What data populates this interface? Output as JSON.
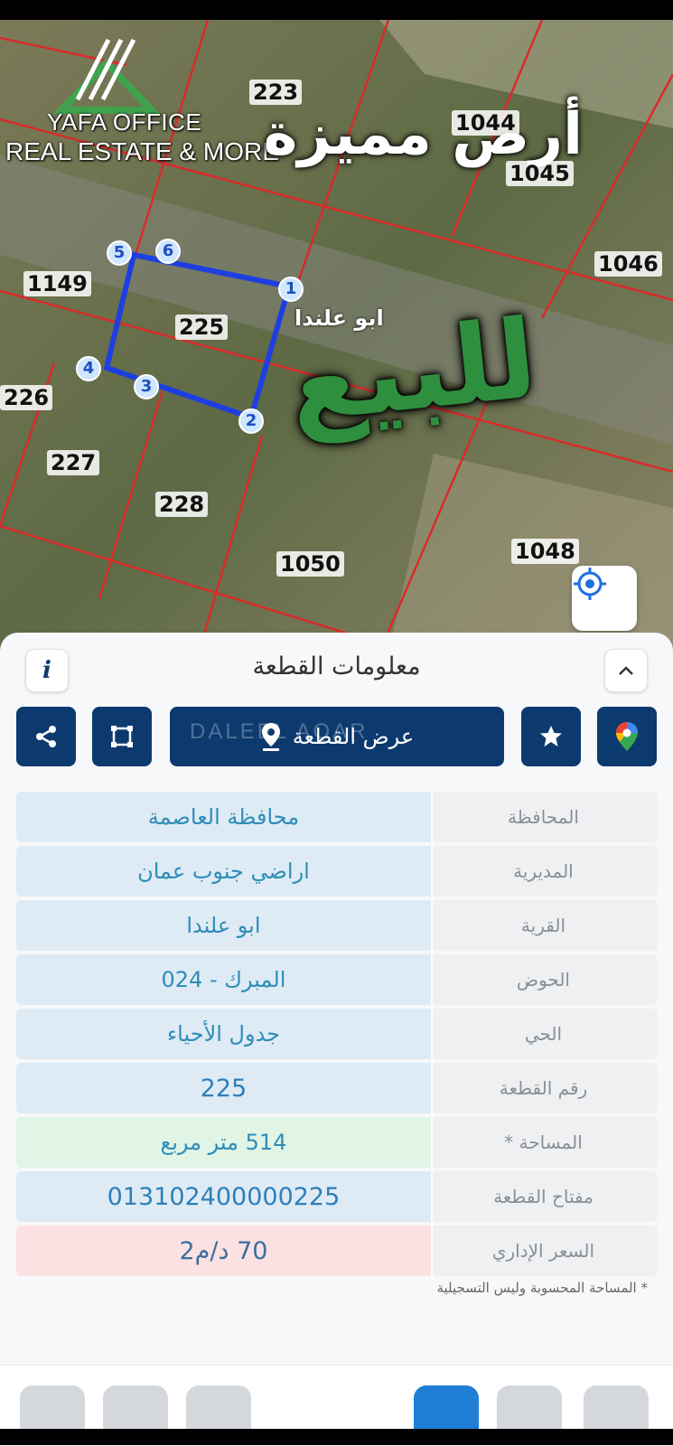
{
  "map": {
    "logo": {
      "line1": "YAFA OFFICE",
      "line2": "REAL ESTATE & MORE"
    },
    "promo_top": "أرض مميزة",
    "promo_main": "للبيع",
    "village_label": "ابو علندا",
    "plots": {
      "p223": "223",
      "p1044": "1044",
      "p1045": "1045",
      "p1046": "1046",
      "p1149": "1149",
      "p225": "225",
      "p226": "226",
      "p227": "227",
      "p228": "228",
      "p1050": "1050",
      "p1048": "1048"
    },
    "vertices": [
      "1",
      "2",
      "3",
      "4",
      "5",
      "6"
    ],
    "boundary_color": "#1e3fe0",
    "parcel_line_color": "#d92b2b"
  },
  "sheet": {
    "title": "معلومات القطعة",
    "info_label": "i",
    "view_button_label": "عرض القطعة",
    "watermark": "DALEEL AQAR",
    "rows": [
      {
        "label": "المحافظة",
        "value": "محافظة العاصمة"
      },
      {
        "label": "المديرية",
        "value": "اراضي جنوب عمان"
      },
      {
        "label": "القرية",
        "value": "ابو علندا"
      },
      {
        "label": "الحوض",
        "value": "المبرك - 024"
      },
      {
        "label": "الحي",
        "value": "جدول الأحياء"
      },
      {
        "label": "رقم القطعة",
        "value": "225"
      },
      {
        "label": "المساحة *",
        "value": "514   متر مربع"
      },
      {
        "label": "مفتاح القطعة",
        "value": "013102400000225"
      },
      {
        "label": "السعر الإداري",
        "value": "70 د/م2"
      }
    ],
    "footnote": "* المساحة المحسوبة وليس التسجيلية"
  },
  "colors": {
    "primary": "#0d3a6e",
    "accent_green": "#2e8f3e"
  }
}
